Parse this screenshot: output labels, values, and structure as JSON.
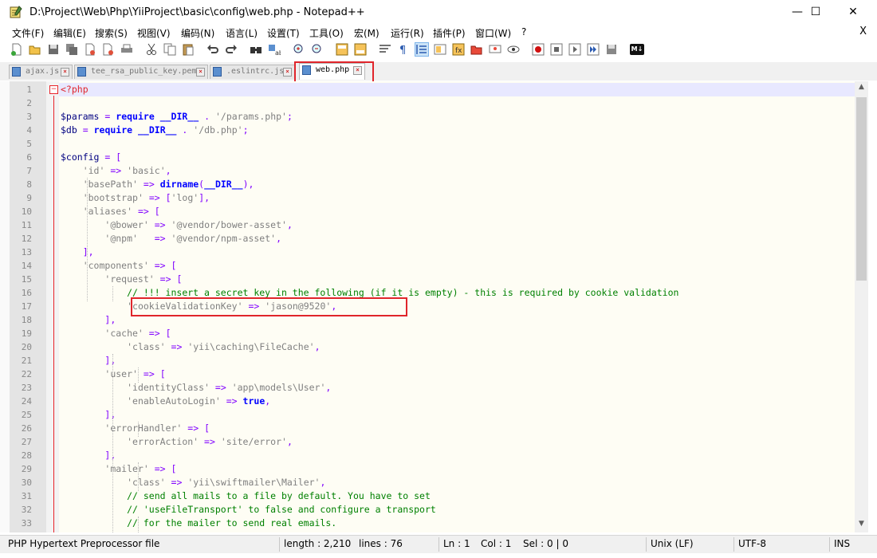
{
  "window": {
    "title": "D:\\Project\\Web\\Php\\YiiProject\\basic\\config\\web.php - Notepad++",
    "minimize": "—",
    "maximize": "☐",
    "close": "✕"
  },
  "menu": {
    "items": [
      "文件(F)",
      "编辑(E)",
      "搜索(S)",
      "视图(V)",
      "编码(N)",
      "语言(L)",
      "设置(T)",
      "工具(O)",
      "宏(M)",
      "运行(R)",
      "插件(P)",
      "窗口(W)",
      "?"
    ],
    "close": "X"
  },
  "toolbar": {
    "icons": [
      "new-file-icon",
      "open-file-icon",
      "save-icon",
      "save-all-icon",
      "close-icon",
      "close-all-icon",
      "print-icon",
      "cut-icon",
      "copy-icon",
      "paste-icon",
      "undo-icon",
      "redo-icon",
      "find-icon",
      "replace-icon",
      "zoom-in-icon",
      "zoom-out-icon",
      "sync-v-icon",
      "sync-h-icon",
      "word-wrap-icon",
      "show-all-chars-icon",
      "indent-guide-icon",
      "doc-map-icon",
      "function-list-icon",
      "folder-workspace-icon",
      "monitor-icon",
      "record-macro-icon",
      "stop-record-icon",
      "play-macro-icon",
      "run-macro-multi-icon",
      "save-macro-icon",
      "markdown-icon"
    ],
    "markdown_label": "M↓"
  },
  "tabs": [
    {
      "label": "ajax.js",
      "active": false
    },
    {
      "label": "tee_rsa_public_key.pem",
      "active": false
    },
    {
      "label": ".eslintrc.js",
      "active": false
    },
    {
      "label": "web.php",
      "active": true
    }
  ],
  "editor": {
    "lines": [
      {
        "n": "1",
        "t": "<?php"
      },
      {
        "n": "2",
        "t": ""
      },
      {
        "n": "3",
        "t": "$params = require __DIR__ . '/params.php';"
      },
      {
        "n": "4",
        "t": "$db = require __DIR__ . '/db.php';"
      },
      {
        "n": "5",
        "t": ""
      },
      {
        "n": "6",
        "t": "$config = ["
      },
      {
        "n": "7",
        "t": "    'id' => 'basic',"
      },
      {
        "n": "8",
        "t": "    'basePath' => dirname(__DIR__),"
      },
      {
        "n": "9",
        "t": "    'bootstrap' => ['log'],"
      },
      {
        "n": "10",
        "t": "    'aliases' => ["
      },
      {
        "n": "11",
        "t": "        '@bower' => '@vendor/bower-asset',"
      },
      {
        "n": "12",
        "t": "        '@npm'   => '@vendor/npm-asset',"
      },
      {
        "n": "13",
        "t": "    ],"
      },
      {
        "n": "14",
        "t": "    'components' => ["
      },
      {
        "n": "15",
        "t": "        'request' => ["
      },
      {
        "n": "16",
        "t": "            // !!! insert a secret key in the following (if it is empty) - this is required by cookie validation"
      },
      {
        "n": "17",
        "t": "            'cookieValidationKey' => 'jason@9520',"
      },
      {
        "n": "18",
        "t": "        ],"
      },
      {
        "n": "19",
        "t": "        'cache' => ["
      },
      {
        "n": "20",
        "t": "            'class' => 'yii\\caching\\FileCache',"
      },
      {
        "n": "21",
        "t": "        ],"
      },
      {
        "n": "22",
        "t": "        'user' => ["
      },
      {
        "n": "23",
        "t": "            'identityClass' => 'app\\models\\User',"
      },
      {
        "n": "24",
        "t": "            'enableAutoLogin' => true,"
      },
      {
        "n": "25",
        "t": "        ],"
      },
      {
        "n": "26",
        "t": "        'errorHandler' => ["
      },
      {
        "n": "27",
        "t": "            'errorAction' => 'site/error',"
      },
      {
        "n": "28",
        "t": "        ],"
      },
      {
        "n": "29",
        "t": "        'mailer' => ["
      },
      {
        "n": "30",
        "t": "            'class' => 'yii\\swiftmailer\\Mailer',"
      },
      {
        "n": "31",
        "t": "            // send all mails to a file by default. You have to set"
      },
      {
        "n": "32",
        "t": "            // 'useFileTransport' to false and configure a transport"
      },
      {
        "n": "33",
        "t": "            // for the mailer to send real emails."
      }
    ]
  },
  "status": {
    "file_type": "PHP Hypertext Preprocessor file",
    "length": "length : 2,210",
    "lines": "lines : 76",
    "ln": "Ln : 1",
    "col": "Col : 1",
    "sel": "Sel : 0 | 0",
    "eol": "Unix (LF)",
    "encoding": "UTF-8",
    "mode": "INS"
  },
  "colors": {
    "keyword": "#0000ff",
    "string": "#808080",
    "comment": "#008000",
    "variable": "#000080",
    "operator": "#8000ff",
    "highlight_box": "#e0252b"
  }
}
